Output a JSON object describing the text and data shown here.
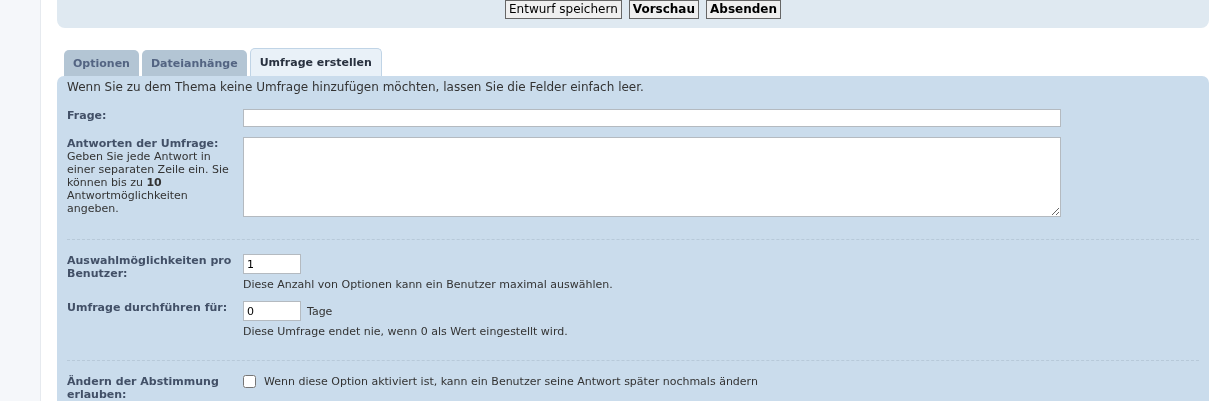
{
  "buttons": [
    {
      "label": "Entwurf speichern",
      "kind": "secondary"
    },
    {
      "label": "Vorschau",
      "kind": "primary"
    },
    {
      "label": "Absenden",
      "kind": "primary"
    }
  ],
  "tabs": [
    {
      "label": "Optionen",
      "selected": false
    },
    {
      "label": "Dateianhänge",
      "selected": false
    },
    {
      "label": "Umfrage erstellen",
      "selected": true
    }
  ],
  "poll": {
    "intro": "Wenn Sie zu dem Thema keine Umfrage hinzufügen möchten, lassen Sie die Felder einfach leer.",
    "groups": [
      {
        "fields": [
          {
            "kind": "text",
            "label": "Frage:"
          },
          {
            "kind": "textarea",
            "label": "Antworten der Umfrage:",
            "hint": "Geben Sie jede Antwort in einer separaten Zeile ein. Sie können bis zu **10** Antwortmöglichkeiten angeben."
          }
        ]
      },
      {
        "fields": [
          {
            "kind": "number",
            "label": "Auswahlmöglichkeiten pro Benutzer:",
            "value": "1",
            "explain": "Diese Anzahl von Optionen kann ein Benutzer maximal auswählen."
          },
          {
            "kind": "number",
            "label": "Umfrage durchführen für:",
            "value": "0",
            "unit": "Tage",
            "explain": "Diese Umfrage endet nie, wenn 0 als Wert eingestellt wird."
          }
        ]
      },
      {
        "fields": [
          {
            "kind": "checkbox",
            "label": "Ändern der Abstimmung erlauben:",
            "checked": false,
            "text": "Wenn diese Option aktiviert ist, kann ein Benutzer seine Antwort später nochmals ändern"
          }
        ]
      }
    ]
  }
}
